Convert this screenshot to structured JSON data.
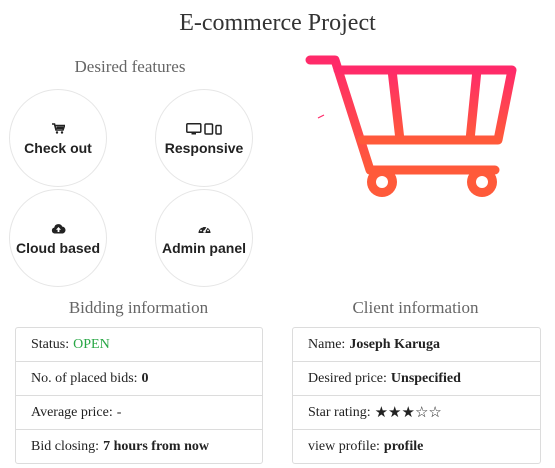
{
  "page": {
    "title": "E-commerce Project"
  },
  "features": {
    "heading": "Desired features",
    "items": [
      {
        "label": "Check out",
        "icon": "cart-icon"
      },
      {
        "label": "Responsive",
        "icon": "devices-icon"
      },
      {
        "label": "Cloud based",
        "icon": "cloud-upload-icon"
      },
      {
        "label": "Admin panel",
        "icon": "dashboard-icon"
      }
    ]
  },
  "hero": {
    "icon": "shopping-cart-icon",
    "color_top": "#ff2a6a",
    "color_bottom": "#ff5a3a"
  },
  "bidding": {
    "heading": "Bidding information",
    "status_label": "Status:",
    "status_value": "OPEN",
    "status_color": "#28a745",
    "bids_label": "No. of placed bids:",
    "bids_value": "0",
    "avg_label": "Average price:",
    "avg_value": "-",
    "closing_label": "Bid closing:",
    "closing_value": "7 hours from now"
  },
  "client": {
    "heading": "Client information",
    "name_label": "Name:",
    "name_value": "Joseph Karuga",
    "price_label": "Desired price:",
    "price_value": "Unspecified",
    "rating_label": "Star rating:",
    "rating_stars": "★★★☆☆",
    "rating_value": 3,
    "rating_max": 5,
    "profile_label": "view profile:",
    "profile_value": "profile"
  }
}
